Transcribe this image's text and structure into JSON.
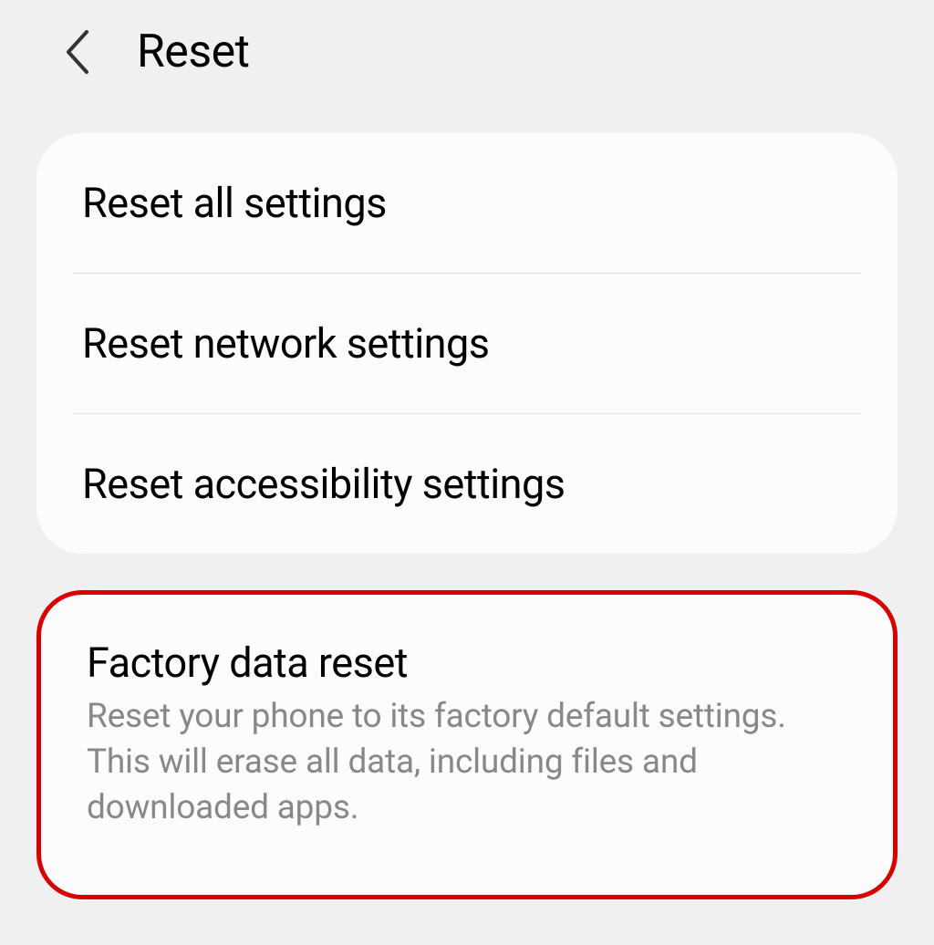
{
  "header": {
    "title": "Reset"
  },
  "group1": {
    "items": [
      {
        "title": "Reset all settings"
      },
      {
        "title": "Reset network settings"
      },
      {
        "title": "Reset accessibility settings"
      }
    ]
  },
  "group2": {
    "items": [
      {
        "title": "Factory data reset",
        "description": "Reset your phone to its factory default settings. This will erase all data, including files and downloaded apps."
      }
    ]
  }
}
